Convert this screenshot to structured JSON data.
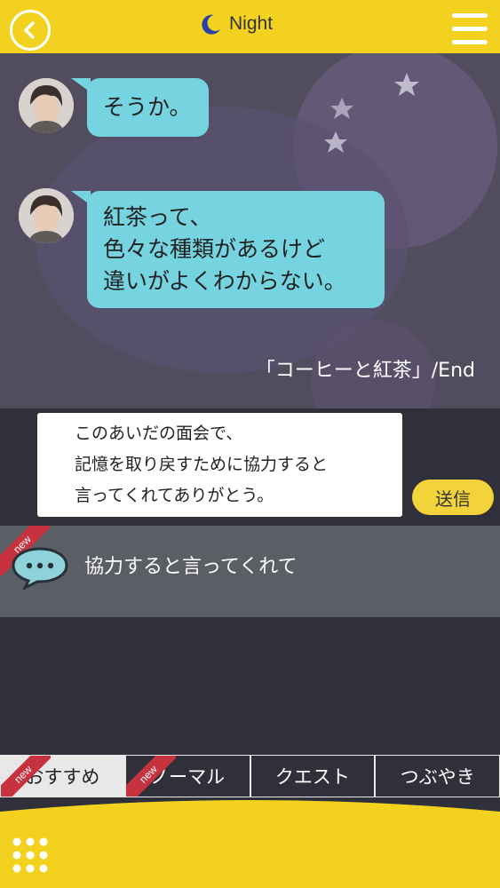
{
  "header": {
    "mode_label": "Night",
    "back_icon": "chevron-left-icon",
    "mode_icon": "moon-icon",
    "menu_icon": "hamburger-menu-icon",
    "bar_color": "#f2d21f"
  },
  "chat": {
    "messages": [
      {
        "text": "そうか。"
      },
      {
        "text": "紅茶って、\n色々な種類があるけど\n違いがよくわからない。"
      }
    ],
    "end_label": "「コーヒーと紅茶」/End",
    "bubble_color": "#76d4e0"
  },
  "reply": {
    "text": "このあいだの面会で、\n記憶を取り戻すために協力すると\n言ってくれてありがとう。",
    "send_label": "送信"
  },
  "suggestion": {
    "badge": "new",
    "text": "協力すると言ってくれて",
    "icon": "speech-bubble-icon"
  },
  "tabs": [
    {
      "label": "おすすめ",
      "badge": "new"
    },
    {
      "label": "ノーマル",
      "badge": "new"
    },
    {
      "label": "クエスト"
    },
    {
      "label": "つぶやき"
    }
  ],
  "footer": {
    "grid_icon": "grid-menu-icon"
  }
}
